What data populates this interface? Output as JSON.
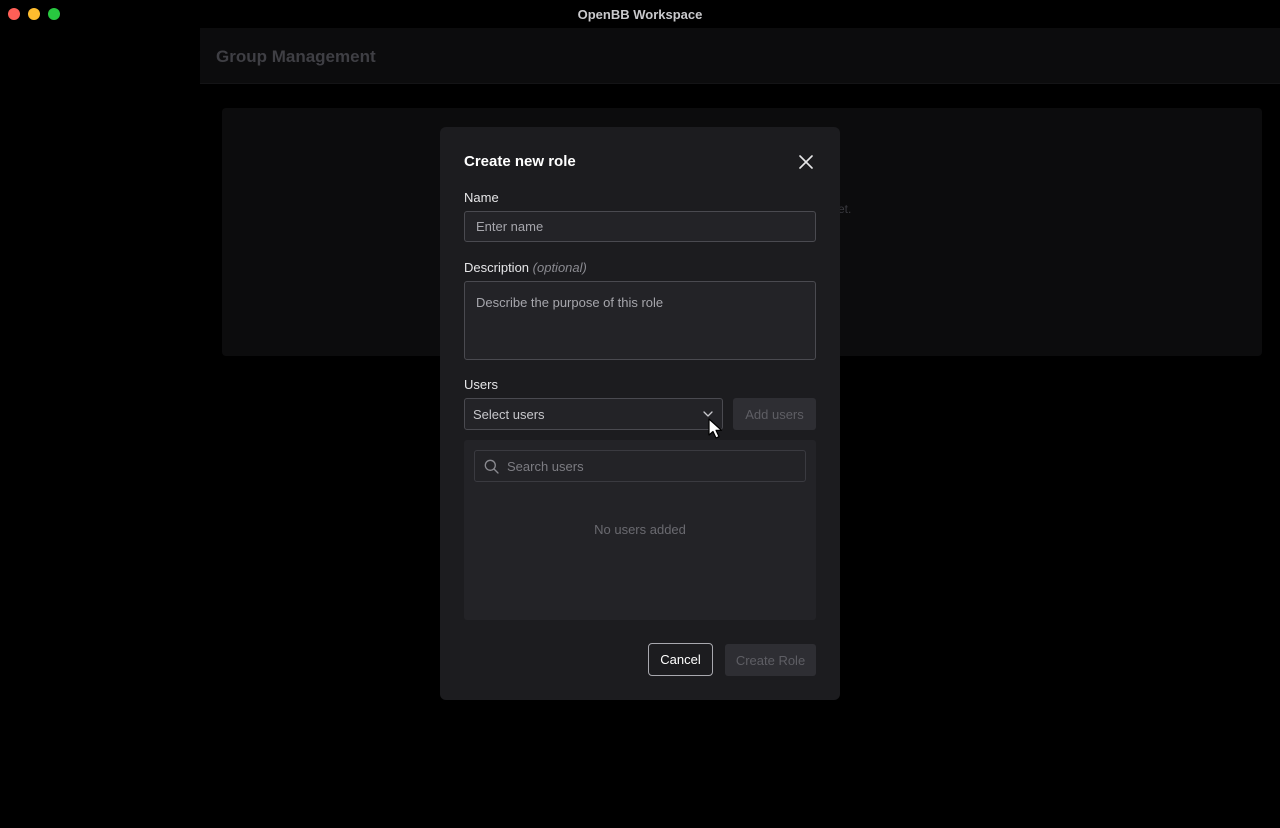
{
  "window": {
    "title": "OpenBB Workspace"
  },
  "page": {
    "title": "Group Management",
    "card_text_fragment": "et."
  },
  "modal": {
    "title": "Create new role",
    "name_label": "Name",
    "name_placeholder": "Enter name",
    "name_value": "",
    "description_label": "Description",
    "description_optional": "(optional)",
    "description_placeholder": "Describe the purpose of this role",
    "description_value": "",
    "users_label": "Users",
    "users_select_value": "Select users",
    "add_users_label": "Add users",
    "search_placeholder": "Search users",
    "empty_state": "No users added",
    "cancel_label": "Cancel",
    "create_label": "Create Role"
  },
  "icons": {
    "close": "close-icon",
    "chevron": "chevron-down-icon",
    "search": "search-icon",
    "cursor": "mouse-pointer-icon"
  },
  "colors": {
    "modal_bg": "#1c1c1f",
    "input_bg": "#232327",
    "disabled_btn_bg": "#2e2e33",
    "traffic_red": "#ff5f57",
    "traffic_yellow": "#febc2e",
    "traffic_green": "#28c840"
  }
}
